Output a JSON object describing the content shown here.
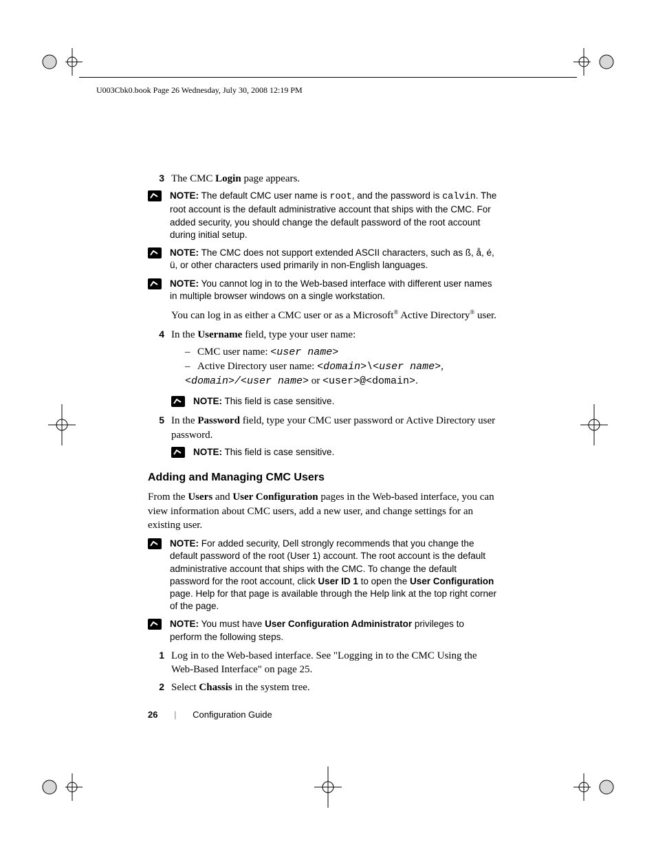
{
  "header": {
    "running": "U003Cbk0.book  Page 26  Wednesday, July 30, 2008  12:19 PM"
  },
  "steps": {
    "s3": {
      "num": "3",
      "pre": "The CMC ",
      "bold": "Login",
      "post": " page appears."
    },
    "note1": {
      "label": "NOTE:",
      "t1": " The default CMC user name is ",
      "mono1": "root",
      "t2": ", and the password is ",
      "mono2": "calvin",
      "t3": ". The root account is the default administrative account that ships with the CMC. For added security, you should change the default password of the root account during initial setup."
    },
    "note2": {
      "label": "NOTE:",
      "text": " The CMC does not support extended ASCII characters, such as ß, å, é, ü, or other characters used primarily in non-English languages."
    },
    "note3": {
      "label": "NOTE:",
      "text": " You cannot log in to the Web-based interface with different user names in multiple browser windows on a single workstation."
    },
    "afterNotes": {
      "t1": "You can log in as either a CMC user or as a Microsoft",
      "r1": "®",
      "t2": " Active Directory",
      "r2": "®",
      "t3": " user."
    },
    "s4": {
      "num": "4",
      "pre": "In the ",
      "bold": "Username",
      "post": " field, type your user name:",
      "b1_pre": "CMC user name: ",
      "b1_mono": "<user name>",
      "b2_pre": "Active Directory user name: ",
      "b2_m1": "<domain>\\<user name>",
      "b2_sep": ", ",
      "b2_m2": "<domain>/<user name>",
      "b2_or": " or ",
      "b2_m3": "<user>@<domain>",
      "b2_dot": "."
    },
    "note4": {
      "label": "NOTE:",
      "text": " This field is case sensitive."
    },
    "s5": {
      "num": "5",
      "pre": "In the ",
      "bold": "Password",
      "post": " field, type your CMC user password or Active Directory user password."
    },
    "note5": {
      "label": "NOTE:",
      "text": " This field is case sensitive."
    }
  },
  "section": {
    "heading": "Adding and Managing CMC Users",
    "p_pre": "From the ",
    "p_b1": "Users",
    "p_mid1": " and ",
    "p_b2": "User Configuration",
    "p_post": " pages in the Web-based interface, you can view information about CMC users, add a new user, and change settings for an existing user.",
    "note6": {
      "label": "NOTE:",
      "t1": " For added security, Dell strongly recommends that you change the default password of the root (User 1) account. The root account is the default administrative account that ships with the CMC. To change the default password for the root account, click ",
      "b1": "User ID 1",
      "t2": " to open the ",
      "b2": "User Configuration",
      "t3": " page. Help for that page is available through the Help link at the top right corner of the page."
    },
    "note7": {
      "label": "NOTE:",
      "t1": " You must have ",
      "b1": "User Configuration Administrator",
      "t2": " privileges to perform the following steps."
    },
    "s1": {
      "num": "1",
      "text": "Log in to the Web-based interface. See \"Logging in to the CMC Using the Web-Based Interface\" on page 25."
    },
    "s2": {
      "num": "2",
      "pre": "Select ",
      "bold": "Chassis",
      "post": " in the system tree."
    }
  },
  "footer": {
    "page": "26",
    "title": "Configuration Guide"
  }
}
